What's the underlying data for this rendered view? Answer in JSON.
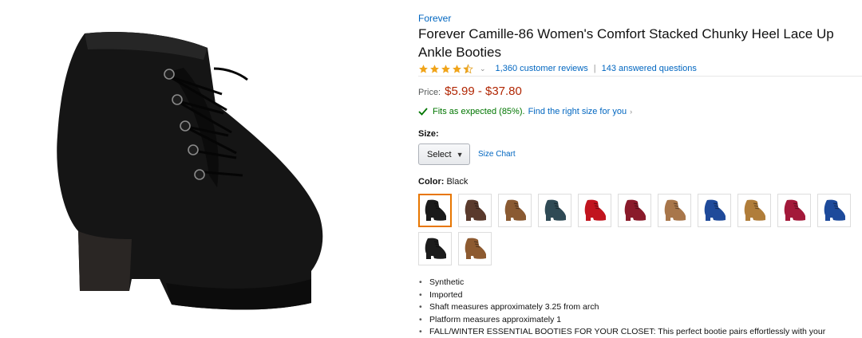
{
  "product": {
    "brand": "Forever",
    "title": "Forever Camille-86 Women's Comfort Stacked Chunky Heel Lace Up Ankle Booties",
    "rating_stars": 4.5,
    "reviews_label": "1,360 customer reviews",
    "questions_label": "143 answered questions",
    "price_label": "Price:",
    "price_value": "$5.99 - $37.80",
    "fit_text": "Fits as expected (85%).",
    "fit_link": "Find the right size for you",
    "size_label": "Size:",
    "size_select_value": "Select",
    "size_chart_label": "Size Chart",
    "color_label": "Color:",
    "color_value": "Black",
    "swatches": [
      {
        "name": "black",
        "color": "#1a1a1a",
        "selected": true
      },
      {
        "name": "brown",
        "color": "#5a3a2c"
      },
      {
        "name": "tan",
        "color": "#8a5a32"
      },
      {
        "name": "teal",
        "color": "#2f4a55"
      },
      {
        "name": "red",
        "color": "#c1141e"
      },
      {
        "name": "burgundy",
        "color": "#8a1a2a"
      },
      {
        "name": "light-tan",
        "color": "#a8764a"
      },
      {
        "name": "blue",
        "color": "#1f4a9a"
      },
      {
        "name": "leopard",
        "color": "#b07d3a"
      },
      {
        "name": "wine",
        "color": "#a3193a"
      },
      {
        "name": "royal-blue",
        "color": "#1d4a9b"
      },
      {
        "name": "black-2",
        "color": "#1b1b1b"
      },
      {
        "name": "camel",
        "color": "#8d5a30"
      }
    ],
    "bullets": [
      "Synthetic",
      "Imported",
      "Shaft measures approximately 3.25 from arch",
      "Platform measures approximately 1",
      "FALL/WINTER ESSENTIAL BOOTIES FOR YOUR CLOSET: This perfect bootie pairs effortlessly with your"
    ],
    "colors": {
      "link": "#0066c0",
      "price": "#B12704",
      "star": "#f0a41a",
      "fit": "#007600",
      "selected_border": "#e77600"
    }
  }
}
